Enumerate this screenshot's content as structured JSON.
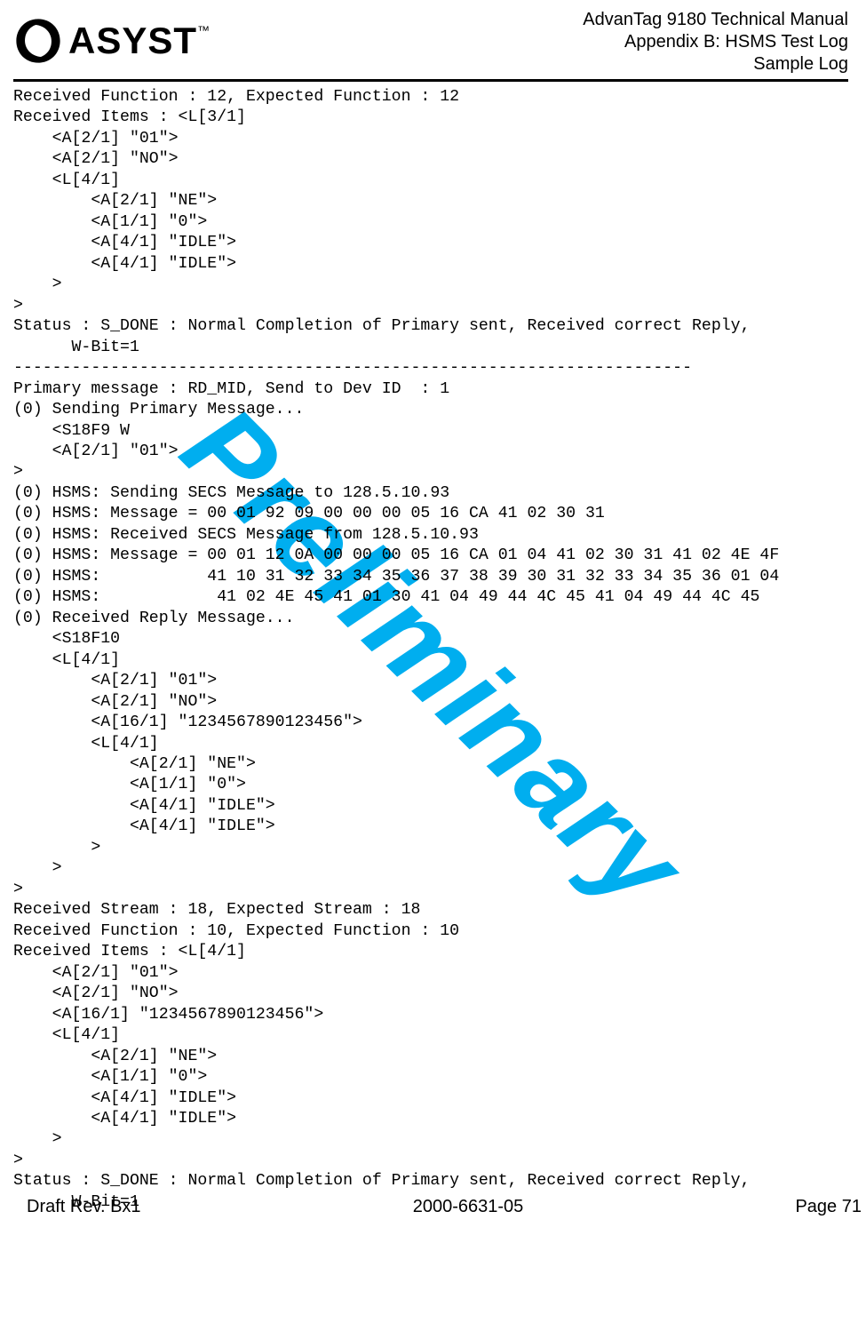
{
  "header": {
    "logo_text": "ASYST",
    "logo_tm": "™",
    "line1": "AdvanTag 9180 Technical Manual",
    "line2": "Appendix B: HSMS Test Log",
    "line3": "Sample Log"
  },
  "watermark": "Preliminary",
  "body_lines": [
    "Received Function : 12, Expected Function : 12",
    "Received Items : <L[3/1]",
    "    <A[2/1] \"01\">",
    "    <A[2/1] \"NO\">",
    "    <L[4/1]",
    "        <A[2/1] \"NE\">",
    "        <A[1/1] \"0\">",
    "        <A[4/1] \"IDLE\">",
    "        <A[4/1] \"IDLE\">",
    "    >",
    ">",
    "Status : S_DONE : Normal Completion of Primary sent, Received correct Reply,",
    "      W-Bit=1",
    "----------------------------------------------------------------------",
    "Primary message : RD_MID, Send to Dev ID  : 1",
    "(0) Sending Primary Message...",
    "    <S18F9 W",
    "    <A[2/1] \"01\">",
    ">",
    "(0) HSMS: Sending SECS Message to 128.5.10.93",
    "(0) HSMS: Message = 00 01 92 09 00 00 00 05 16 CA 41 02 30 31",
    "(0) HSMS: Received SECS Message from 128.5.10.93",
    "(0) HSMS: Message = 00 01 12 0A 00 00 00 05 16 CA 01 04 41 02 30 31 41 02 4E 4F",
    "(0) HSMS:           41 10 31 32 33 34 35 36 37 38 39 30 31 32 33 34 35 36 01 04",
    "(0) HSMS:            41 02 4E 45 41 01 30 41 04 49 44 4C 45 41 04 49 44 4C 45",
    "(0) Received Reply Message...",
    "    <S18F10",
    "    <L[4/1]",
    "        <A[2/1] \"01\">",
    "        <A[2/1] \"NO\">",
    "        <A[16/1] \"1234567890123456\">",
    "        <L[4/1]",
    "            <A[2/1] \"NE\">",
    "            <A[1/1] \"0\">",
    "            <A[4/1] \"IDLE\">",
    "            <A[4/1] \"IDLE\">",
    "        >",
    "    >",
    ">",
    "Received Stream : 18, Expected Stream : 18",
    "Received Function : 10, Expected Function : 10",
    "Received Items : <L[4/1]",
    "    <A[2/1] \"01\">",
    "    <A[2/1] \"NO\">",
    "    <A[16/1] \"1234567890123456\">",
    "    <L[4/1]",
    "        <A[2/1] \"NE\">",
    "        <A[1/1] \"0\">",
    "        <A[4/1] \"IDLE\">",
    "        <A[4/1] \"IDLE\">",
    "    >",
    ">",
    "Status : S_DONE : Normal Completion of Primary sent, Received correct Reply,",
    "      W-Bit=1"
  ],
  "footer": {
    "left": "Draft Rev. Bx1",
    "center": "2000-6631-05",
    "right": "Page 71"
  }
}
